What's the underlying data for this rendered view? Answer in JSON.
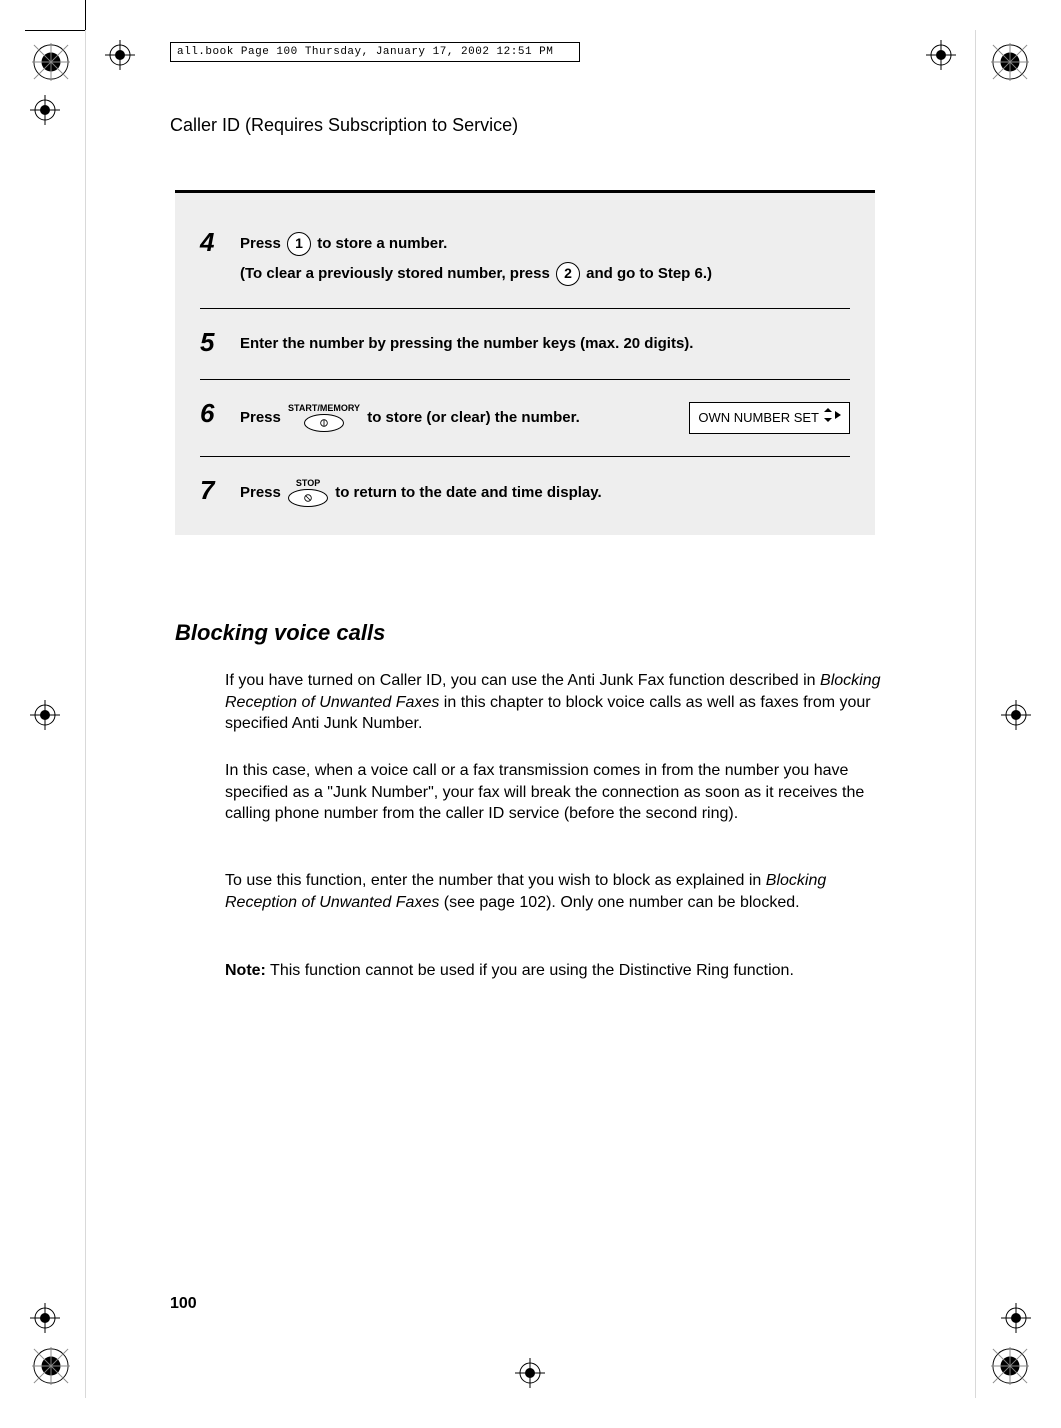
{
  "header_line": "all.book  Page 100  Thursday, January 17, 2002  12:51 PM",
  "section_title": "Caller ID (Requires Subscription to Service)",
  "steps": {
    "s4": {
      "num": "4",
      "line1a": "Press ",
      "key1": "1",
      "line1b": " to store a number.",
      "line2a": "(To clear a previously stored number, press ",
      "key2": "2",
      "line2b": " and go to Step 6.)"
    },
    "s5": {
      "num": "5",
      "text": "Enter the number by pressing the number keys (max. 20 digits)."
    },
    "s6": {
      "num": "6",
      "text_a": "Press ",
      "btn_label": "START/MEMORY",
      "text_b": " to store (or clear) the number.",
      "display": "OWN NUMBER SET"
    },
    "s7": {
      "num": "7",
      "text_a": "Press ",
      "btn_label": "STOP",
      "text_b": " to return to the date and time display."
    }
  },
  "heading2": "Blocking voice calls",
  "paragraphs": {
    "p1a": "If you have turned on Caller ID, you can use the Anti Junk Fax function described in ",
    "p1em": "Blocking Reception of Unwanted Faxes",
    "p1b": " in this chapter to block voice calls as well as faxes from your specified Anti Junk Number.",
    "p2": "In this case, when a voice call or a fax transmission comes in from the number you have specified as a \"Junk Number\", your fax will break the connection as soon as it receives the calling phone number from the caller ID service (before the second ring).",
    "p3a": "To use this function, enter the number that you wish to block as explained in ",
    "p3em": "Blocking Reception of Unwanted Faxes",
    "p3b": " (see page 102). Only one number can be blocked.",
    "p4label": "Note:",
    "p4": " This function cannot be used if you are using the Distinctive Ring function."
  },
  "page_number": "100"
}
